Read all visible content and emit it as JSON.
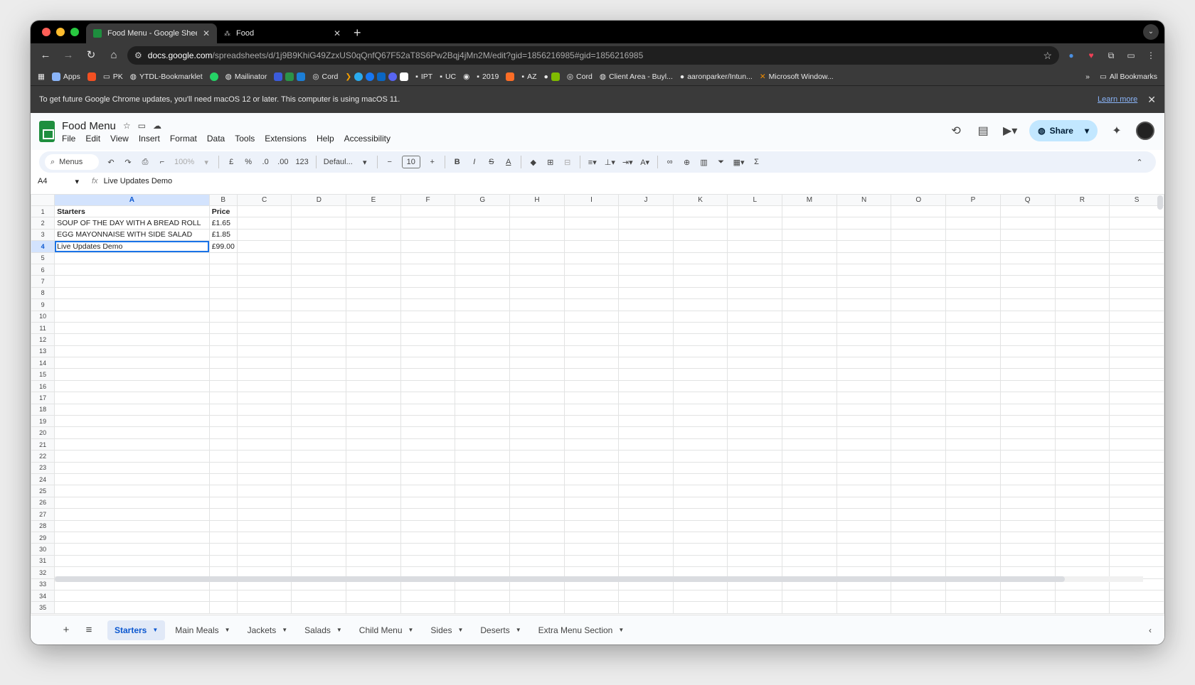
{
  "browser": {
    "tabs": [
      {
        "title": "Food Menu - Google Sheets",
        "active": true
      },
      {
        "title": "Food",
        "active": false
      }
    ],
    "url_host": "docs.google.com",
    "url_path": "/spreadsheets/d/1j9B9KhiG49ZzxUS0qQnfQ67F52aT8S6Pw2Bqj4jMn2M/edit?gid=1856216985#gid=1856216985",
    "bookmarks": [
      "Apps",
      "PK",
      "YTDL-Bookmarklet",
      "Mailinator",
      "Cord",
      "IPT",
      "UC",
      "2019",
      "AZ",
      "Cord",
      "Client Area - Buyl...",
      "aaronparker/Intun...",
      "Microsoft Window..."
    ],
    "all_bookmarks": "All Bookmarks",
    "infobar_text": "To get future Google Chrome updates, you'll need macOS 12 or later. This computer is using macOS 11.",
    "learn_more": "Learn more"
  },
  "doc": {
    "title": "Food Menu",
    "menu": [
      "File",
      "Edit",
      "View",
      "Insert",
      "Format",
      "Data",
      "Tools",
      "Extensions",
      "Help",
      "Accessibility"
    ],
    "share_label": "Share"
  },
  "toolbar": {
    "menus_label": "Menus",
    "zoom": "100%",
    "currency": "£",
    "percent": "%",
    "dec_down": ".0",
    "dec_up": ".00",
    "num_format": "123",
    "font": "Defaul...",
    "font_size": "10"
  },
  "formula_bar": {
    "cell_ref": "A4",
    "fx": "fx",
    "value": "Live Updates Demo"
  },
  "grid": {
    "columns": [
      "A",
      "B",
      "C",
      "D",
      "E",
      "F",
      "G",
      "H",
      "I",
      "J",
      "K",
      "L",
      "M",
      "N",
      "O",
      "P",
      "Q",
      "R",
      "S"
    ],
    "rows": [
      [
        "Starters",
        "Price"
      ],
      [
        "SOUP OF THE DAY WITH A BREAD ROLL",
        "£1.65"
      ],
      [
        "EGG MAYONNAISE WITH SIDE SALAD",
        "£1.85"
      ],
      [
        "Live Updates Demo",
        "£99.00"
      ]
    ],
    "row_count": 35,
    "selected_cell": "A4"
  },
  "sheet_tabs": [
    "Starters",
    "Main Meals",
    "Jackets",
    "Salads",
    "Child Menu",
    "Sides",
    "Deserts",
    "Extra Menu Section"
  ],
  "active_sheet": "Starters"
}
